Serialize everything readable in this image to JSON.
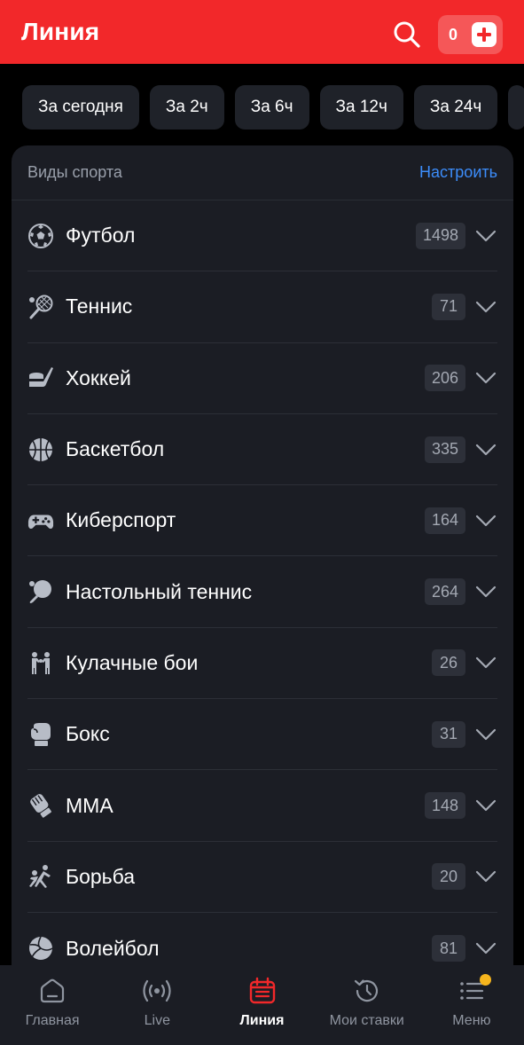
{
  "header": {
    "title": "Линия",
    "coupon_count": "0",
    "search_icon": "search-icon",
    "plus_icon": "plus-icon"
  },
  "filters": [
    {
      "label": "За сегодня"
    },
    {
      "label": "За 2ч"
    },
    {
      "label": "За 6ч"
    },
    {
      "label": "За 12ч"
    },
    {
      "label": "За 24ч"
    }
  ],
  "sports_card": {
    "title": "Виды спорта",
    "configure_label": "Настроить",
    "items": [
      {
        "name": "Футбол",
        "count": "1498",
        "icon": "football-icon"
      },
      {
        "name": "Теннис",
        "count": "71",
        "icon": "tennis-icon"
      },
      {
        "name": "Хоккей",
        "count": "206",
        "icon": "hockey-icon"
      },
      {
        "name": "Баскетбол",
        "count": "335",
        "icon": "basketball-icon"
      },
      {
        "name": "Киберспорт",
        "count": "164",
        "icon": "gamepad-icon"
      },
      {
        "name": "Настольный теннис",
        "count": "264",
        "icon": "table-tennis-icon"
      },
      {
        "name": "Кулачные бои",
        "count": "26",
        "icon": "fist-fight-icon"
      },
      {
        "name": "Бокс",
        "count": "31",
        "icon": "boxing-glove-icon"
      },
      {
        "name": "MMA",
        "count": "148",
        "icon": "mma-glove-icon"
      },
      {
        "name": "Борьба",
        "count": "20",
        "icon": "wrestling-icon"
      },
      {
        "name": "Волейбол",
        "count": "81",
        "icon": "volleyball-icon"
      }
    ]
  },
  "bottom_nav": [
    {
      "label": "Главная",
      "icon": "home-icon",
      "active": false
    },
    {
      "label": "Live",
      "icon": "live-broadcast-icon",
      "active": false
    },
    {
      "label": "Линия",
      "icon": "calendar-icon",
      "active": true
    },
    {
      "label": "Мои ставки",
      "icon": "history-icon",
      "active": false
    },
    {
      "label": "Меню",
      "icon": "menu-list-icon",
      "active": false
    }
  ],
  "colors": {
    "brand_red": "#f2282a",
    "link_blue": "#3c8dfb",
    "notification_dot": "#f6b51d",
    "card_bg": "#1b1d24"
  }
}
